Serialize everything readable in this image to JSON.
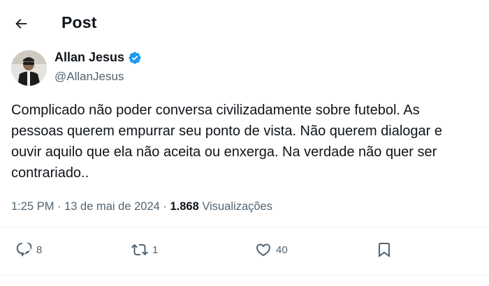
{
  "header": {
    "title": "Post",
    "back_icon": "arrow-left-icon"
  },
  "author": {
    "name": "Allan Jesus",
    "handle": "@AllanJesus",
    "verified_color": "#1d9bf0"
  },
  "tweet": {
    "lines": [
      "Complicado não poder conversa civilizadamente sobre futebol. As",
      "pessoas querem empurrar seu ponto de vista. Não querem dialogar e",
      "ouvir aquilo que ela não aceita ou enxerga. Na verdade não quer ser",
      "contrariado.."
    ]
  },
  "meta": {
    "time": "1:25 PM",
    "sep1": " · ",
    "date": "13 de mai de 2024",
    "sep2": " · ",
    "views_count": "1.868",
    "views_label": " Visualizações"
  },
  "actions": {
    "replies": "8",
    "reposts": "1",
    "likes": "40"
  }
}
